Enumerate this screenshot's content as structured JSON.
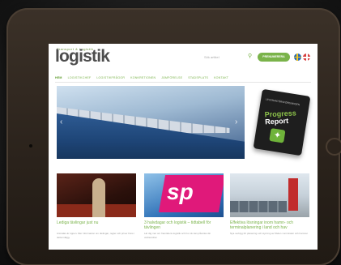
{
  "site": {
    "logo_small": "Transport & Logistik",
    "logo": "logistik",
    "search_placeholder": "Sök artikel",
    "cta_label": "PRENUMERERA",
    "accent_color": "#7ab34a"
  },
  "nav": {
    "items": [
      "Hem",
      "Logistikchef",
      "Logistikfrågor",
      "Konkretionen",
      "Jämförelse",
      "Stadsplats",
      "Kontakt"
    ]
  },
  "hero": {
    "prev_icon": "chevron-left-icon",
    "next_icon": "chevron-right-icon"
  },
  "promo": {
    "tag": "LEVERANTÖRSFÖRENINGEN",
    "title_line1": "Progress",
    "title_line2": "Report"
  },
  "cards": [
    {
      "title": "Lediga tävlingar just nu",
      "text": "Anmälan är öppen. Mer information om tävlingar, regler och priser finns i detta inlägg."
    },
    {
      "title": "3 halvdagar och logistik – tidtabell för tävlingen",
      "text": "Lär dig mer om framtidens logistik och hur du kan påverka din verksamhet."
    },
    {
      "title": "Effektiva lösningar inom hamn- och terminalplanering i land och hav",
      "text": "Nya verktyg för planering och styrning av flöden i terminaler och hamnar."
    }
  ]
}
